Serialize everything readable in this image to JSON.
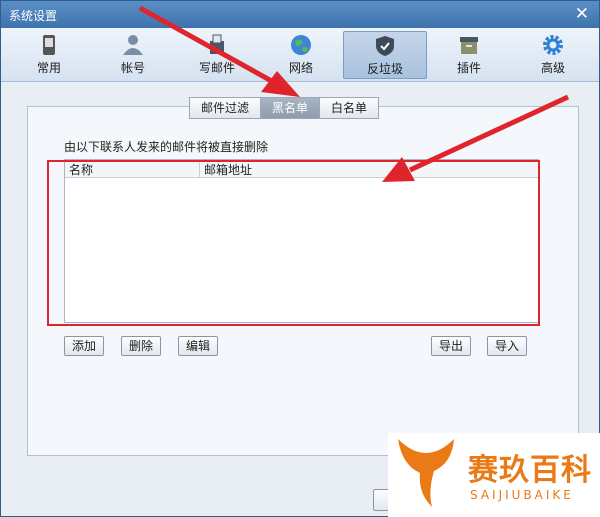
{
  "window": {
    "title": "系统设置",
    "close_glyph": "✕"
  },
  "toolbar": [
    {
      "label": "常用",
      "icon": "phone-icon"
    },
    {
      "label": "帐号",
      "icon": "user-icon"
    },
    {
      "label": "写邮件",
      "icon": "write-mail-icon"
    },
    {
      "label": "网络",
      "icon": "globe-icon"
    },
    {
      "label": "反垃圾",
      "icon": "shield-icon",
      "active": true
    },
    {
      "label": "插件",
      "icon": "box-icon"
    },
    {
      "label": "高级",
      "icon": "gear-icon"
    }
  ],
  "tabs": [
    {
      "label": "邮件过滤"
    },
    {
      "label": "黑名单",
      "active": true
    },
    {
      "label": "白名单"
    }
  ],
  "blacklist": {
    "description": "由以下联系人发来的邮件将被直接删除",
    "columns": [
      "名称",
      "邮箱地址"
    ],
    "rows": []
  },
  "buttons": {
    "add": "添加",
    "delete": "删除",
    "edit": "编辑",
    "export": "导出",
    "import": "导入"
  },
  "watermark": {
    "cn": "赛玖百科",
    "en": "SAIJIUBAIKE"
  },
  "colors": {
    "accent_red": "#e0242b",
    "titlebar": "#3d72ad",
    "watermark": "#e97a16"
  }
}
